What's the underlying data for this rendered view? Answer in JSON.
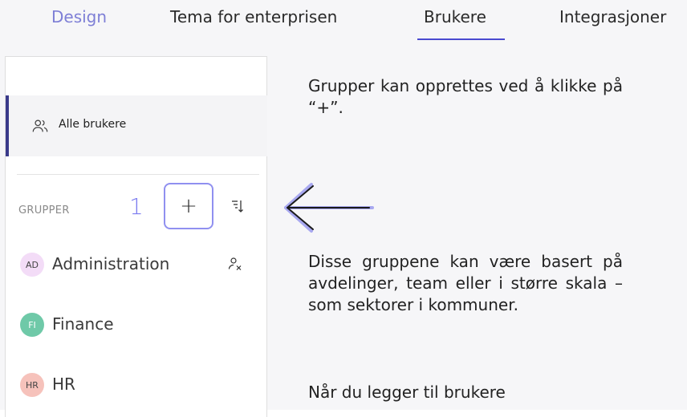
{
  "tabs": [
    {
      "label": "Design"
    },
    {
      "label": "Tema for enterprisen"
    },
    {
      "label": "Brukere"
    },
    {
      "label": "Integrasjoner"
    }
  ],
  "active_tab": "Brukere",
  "sidebar": {
    "all_users_label": "Alle brukere",
    "groups_header": "GRUPPER",
    "step_number": "1",
    "add_button_label": "+",
    "groups": [
      {
        "initials": "AD",
        "name": "Administration",
        "color": "#f3dcf7"
      },
      {
        "initials": "FI",
        "name": "Finance",
        "color": "#6fc9a8"
      },
      {
        "initials": "HR",
        "name": "HR",
        "color": "#f6c2bb"
      }
    ]
  },
  "instructions": {
    "p1": "Grupper kan opprettes ved å klikke på “+”.",
    "p2": "Disse gruppene kan være basert på avdelinger, team eller i større skala – som sektorer i kommuner.",
    "p3": "Når du legger til brukere"
  },
  "colors": {
    "accent": "#7c7cf0",
    "active_underline": "#4a4ad0",
    "sidebar_active_bar": "#3a3a8a"
  },
  "icons": {
    "all_users": "users-icon",
    "sort": "sort-icon",
    "remove_user": "remove-user-icon",
    "arrow": "arrow-left-icon"
  }
}
